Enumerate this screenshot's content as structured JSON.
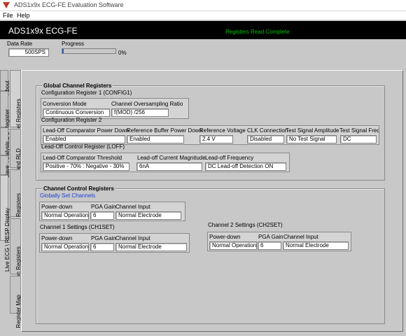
{
  "window": {
    "title": "ADS1x9x ECG-FE Evaluation Software",
    "icon": "ti-logo-icon"
  },
  "menu": {
    "file": "File",
    "help": "Help"
  },
  "header": {
    "app_title": "ADS1x9x ECG-FE",
    "status": "Registers Read Complete",
    "status_color": "#00c000"
  },
  "top": {
    "data_rate_label": "Data Rate",
    "data_rate_value": "500SPS",
    "progress_label": "Progress",
    "progress_percent": "0%",
    "progress_fraction": 0.02
  },
  "side_tabs": [
    "About",
    "ADC Register",
    "Analysis",
    "Save",
    "Live ECG \\ RESP Display"
  ],
  "inner_tabs": [
    "Channel Registers",
    "LOFF and RLD",
    "GPIO Registers",
    "Respiration Registers",
    "Register Map"
  ],
  "global": {
    "title": "Global Channel Registers",
    "config1": {
      "title": "Configuration Register 1 (CONFIG1)",
      "conv_mode_label": "Conversion Mode",
      "conv_mode_value": "Continuous Conversion",
      "oversampling_label": "Channel Oversampling Ratio",
      "oversampling_value": "f(MOD) /256"
    },
    "config2": {
      "title": "Configuration Register 2",
      "loff_comp_pd_label": "Lead-Off Comparator Power Down",
      "loff_comp_pd_value": "Enabled",
      "ref_buf_pd_label": "Reference Buffer Power Down",
      "ref_buf_pd_value": "Enabled",
      "ref_voltage_label": "Reference Voltage",
      "ref_voltage_value": "2.4 V",
      "clk_conn_label": "CLK Connection",
      "clk_conn_value": "Disabled",
      "test_amp_label": "Test Signal Amplitude",
      "test_amp_value": "No Test Signal",
      "test_freq_label": "Test Signal Freq",
      "test_freq_value": "DC"
    },
    "loff": {
      "title": "Lead-Off Control Register (LOFF)",
      "threshold_label": "Lead-Off Comparator Threshold",
      "threshold_value": "Positive - 70% : Negative - 30%",
      "current_label": "Lead-off Current Magnitude",
      "current_value": "6nA",
      "frequency_label": "Lead-off Frequency",
      "frequency_value": "DC Lead-off Detection ON"
    }
  },
  "channel": {
    "title": "Channel Control Registers",
    "globally_set": "Globally Set Channels",
    "col_power_down": "Power-down",
    "col_pga_gain": "PGA Gain",
    "col_channel_input": "Channel Input",
    "global_row": {
      "power_down": "Normal Operation",
      "pga_gain": "6",
      "channel_input": "Normal Electrode"
    },
    "ch1": {
      "title": "Channel 1 Settings (CH1SET)",
      "power_down": "Normal Operation",
      "pga_gain": "6",
      "channel_input": "Normal Electrode"
    },
    "ch2": {
      "title": "Channel 2 Settings (CH2SET)",
      "power_down": "Normal Operation",
      "pga_gain": "6",
      "channel_input": "Normal Electrode"
    }
  }
}
